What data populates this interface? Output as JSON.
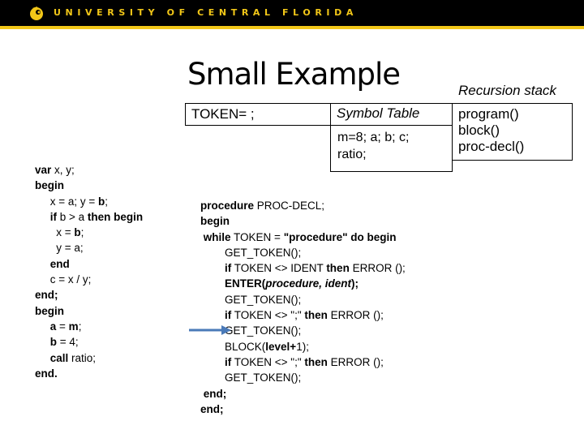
{
  "header": {
    "logo_icon": "pegasus-logo-icon",
    "university_name": "UNIVERSITY OF CENTRAL FLORIDA",
    "colors": {
      "background": "#000000",
      "accent": "#f2c718"
    }
  },
  "slide": {
    "title": "Small Example",
    "token_label": "TOKEN= ;",
    "symbol_table": {
      "header": "Symbol Table",
      "lines": [
        "m=8; a; b; c;",
        "ratio;"
      ]
    },
    "recursion_stack": {
      "header": "Recursion stack",
      "items": [
        "program()",
        "block()",
        "proc-decl()"
      ]
    },
    "program_code": [
      [
        {
          "t": "var",
          "s": "b"
        },
        {
          "t": " x, y;",
          "s": ""
        }
      ],
      [
        {
          "t": "begin",
          "s": "b"
        }
      ],
      [
        {
          "t": "     x = a; y = ",
          "s": ""
        },
        {
          "t": "b",
          "s": "b"
        },
        {
          "t": ";",
          "s": ""
        }
      ],
      [
        {
          "t": "     ",
          "s": ""
        },
        {
          "t": "if",
          "s": "b"
        },
        {
          "t": " b > a ",
          "s": ""
        },
        {
          "t": "then begin",
          "s": "b"
        }
      ],
      [
        {
          "t": "       x = ",
          "s": ""
        },
        {
          "t": "b",
          "s": "b"
        },
        {
          "t": ";",
          "s": ""
        }
      ],
      [
        {
          "t": "       y = a;",
          "s": ""
        }
      ],
      [
        {
          "t": "     ",
          "s": ""
        },
        {
          "t": "end",
          "s": "b"
        }
      ],
      [
        {
          "t": "     c = x / y;",
          "s": ""
        }
      ],
      [
        {
          "t": "end;",
          "s": "b"
        }
      ],
      [
        {
          "t": "begin",
          "s": "b"
        }
      ],
      [
        {
          "t": "     ",
          "s": ""
        },
        {
          "t": "a",
          "s": "b"
        },
        {
          "t": " = ",
          "s": ""
        },
        {
          "t": "m",
          "s": "b"
        },
        {
          "t": ";",
          "s": ""
        }
      ],
      [
        {
          "t": "     ",
          "s": ""
        },
        {
          "t": "b",
          "s": "b"
        },
        {
          "t": " = 4;",
          "s": ""
        }
      ],
      [
        {
          "t": "     ",
          "s": ""
        },
        {
          "t": "call",
          "s": "b"
        },
        {
          "t": " ratio;",
          "s": ""
        }
      ],
      [
        {
          "t": "end.",
          "s": "b"
        }
      ]
    ],
    "procedure_code": [
      [
        {
          "t": "procedure",
          "s": "b"
        },
        {
          "t": " PROC-DECL;",
          "s": ""
        }
      ],
      [
        {
          "t": "begin",
          "s": "b"
        }
      ],
      [
        {
          "t": " ",
          "s": ""
        },
        {
          "t": "while",
          "s": "b"
        },
        {
          "t": " TOKEN = ",
          "s": ""
        },
        {
          "t": "\"procedure\" do begin",
          "s": "b"
        }
      ],
      [
        {
          "t": "        GET_TOKEN();",
          "s": ""
        }
      ],
      [
        {
          "t": "        ",
          "s": ""
        },
        {
          "t": "if",
          "s": "b"
        },
        {
          "t": " TOKEN <> IDENT ",
          "s": ""
        },
        {
          "t": "then",
          "s": "b"
        },
        {
          "t": " ERROR ();",
          "s": ""
        }
      ],
      [
        {
          "t": "        ",
          "s": ""
        },
        {
          "t": "ENTER(",
          "s": "b"
        },
        {
          "t": "procedure, ident",
          "s": "bi"
        },
        {
          "t": ");",
          "s": "b"
        }
      ],
      [
        {
          "t": "        GET_TOKEN();",
          "s": ""
        }
      ],
      [
        {
          "t": "        ",
          "s": ""
        },
        {
          "t": "if",
          "s": "b"
        },
        {
          "t": " TOKEN <> \";\" ",
          "s": ""
        },
        {
          "t": "then",
          "s": "b"
        },
        {
          "t": " ERROR ();",
          "s": ""
        }
      ],
      [
        {
          "t": "        GET_TOKEN();",
          "s": ""
        }
      ],
      [
        {
          "t": "        BLOCK(",
          "s": ""
        },
        {
          "t": "level+",
          "s": "b"
        },
        {
          "t": "1);",
          "s": ""
        }
      ],
      [
        {
          "t": "        ",
          "s": ""
        },
        {
          "t": "if",
          "s": "b"
        },
        {
          "t": " TOKEN <> \";\" ",
          "s": ""
        },
        {
          "t": "then",
          "s": "b"
        },
        {
          "t": " ERROR ();",
          "s": ""
        }
      ],
      [
        {
          "t": "        GET_TOKEN();",
          "s": ""
        }
      ],
      [
        {
          "t": " ",
          "s": ""
        },
        {
          "t": "end;",
          "s": "b"
        }
      ],
      [
        {
          "t": "end;",
          "s": "b"
        }
      ]
    ],
    "current_line_pointer": {
      "icon": "arrow-right-icon",
      "points_to_line": 9,
      "color": "#4a7ab8"
    }
  }
}
